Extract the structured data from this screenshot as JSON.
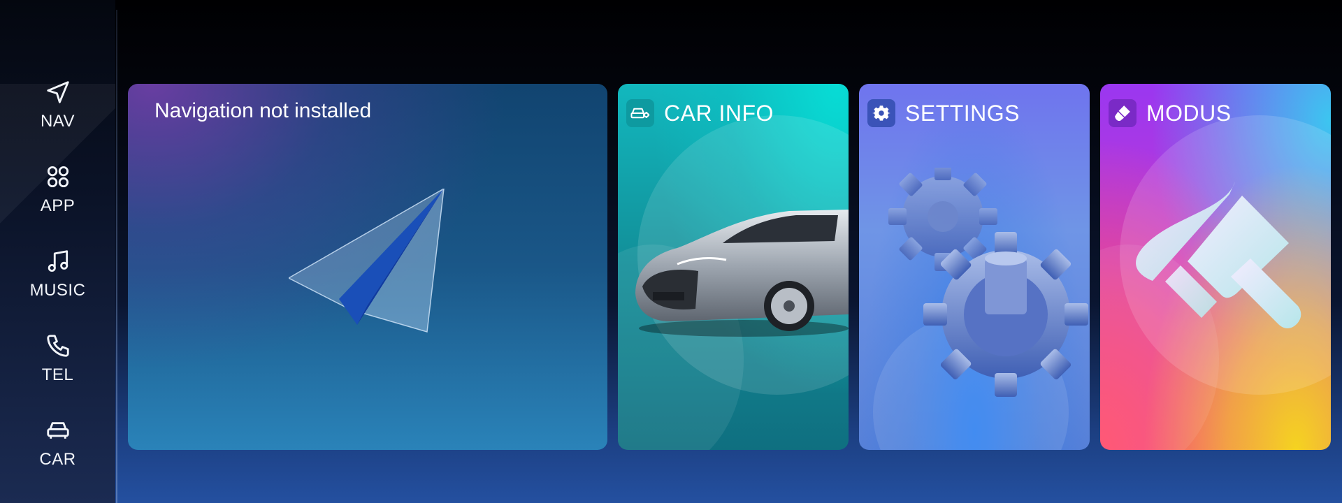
{
  "sidebar": {
    "items": [
      {
        "label": "NAV",
        "icon": "navigation-arrow-icon"
      },
      {
        "label": "APP",
        "icon": "apps-grid-icon"
      },
      {
        "label": "MUSIC",
        "icon": "music-note-icon"
      },
      {
        "label": "TEL",
        "icon": "phone-icon"
      },
      {
        "label": "CAR",
        "icon": "car-icon"
      }
    ]
  },
  "cards": {
    "navigation": {
      "title": "Navigation not installed",
      "icon": "paper-plane-icon"
    },
    "car_info": {
      "title": "CAR INFO",
      "icon": "car-settings-icon",
      "accent": "#0e9aa0"
    },
    "settings": {
      "title": "SETTINGS",
      "icon": "gear-icon",
      "accent": "#3a53b8"
    },
    "modus": {
      "title": "MODUS",
      "icon": "paint-brush-icon",
      "accent": "#7a2ac6"
    }
  }
}
